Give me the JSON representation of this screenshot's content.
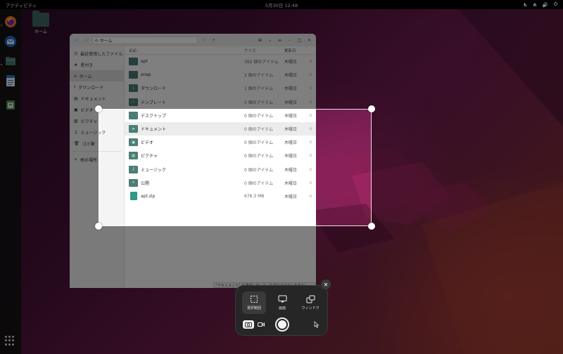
{
  "topbar": {
    "activities": "アクティビティ",
    "clock": "5月30日 12:48",
    "tray_icons": [
      "accessibility-icon",
      "network-icon",
      "volume-icon",
      "power-icon"
    ]
  },
  "dock": {
    "items": [
      "firefox-icon",
      "thunderbird-icon",
      "files-icon",
      "writer-icon",
      "trash-icon"
    ],
    "app_grid": "show-apps-icon"
  },
  "desktop": {
    "home_label": "ホーム"
  },
  "file_manager": {
    "path": "ホーム",
    "sidebar": [
      {
        "label": "最近使用したファイル",
        "icon": "clock-icon"
      },
      {
        "label": "最近使用したファイル",
        "icon": "clock-icon"
      },
      {
        "label": "星付き",
        "icon": "star-icon"
      },
      {
        "label": "ホーム",
        "icon": "home-icon",
        "active": true
      },
      {
        "label": "ダウンロード",
        "icon": "download-icon"
      },
      {
        "label": "ドキュメント",
        "icon": "document-icon"
      },
      {
        "label": "ビデオ",
        "icon": "video-icon"
      },
      {
        "label": "ピクチャ",
        "icon": "picture-icon"
      },
      {
        "label": "ミュージック",
        "icon": "music-icon"
      },
      {
        "label": "ゴミ箱",
        "icon": "trash-icon"
      },
      {
        "label": "他の場所",
        "icon": "plus-icon"
      }
    ],
    "columns": {
      "name": "名前",
      "size": "サイズ",
      "date": "更新日"
    },
    "rows": [
      {
        "name": "apt",
        "size": "382 個のアイテム",
        "date": "木曜日",
        "icon": "folder-icon",
        "glyph": ""
      },
      {
        "name": "snap",
        "size": "2 個のアイテム",
        "date": "木曜日",
        "icon": "folder-icon",
        "glyph": ""
      },
      {
        "name": "ダウンロード",
        "size": "1 個のアイテム",
        "date": "木曜日",
        "icon": "folder-download-icon",
        "glyph": "↓"
      },
      {
        "name": "テンプレート",
        "size": "0 個のアイテム",
        "date": "木曜日",
        "icon": "folder-template-icon",
        "glyph": "▭"
      },
      {
        "name": "デスクトップ",
        "size": "0 個のアイテム",
        "date": "木曜日",
        "icon": "folder-desktop-icon",
        "glyph": ""
      },
      {
        "name": "ドキュメント",
        "size": "0 個のアイテム",
        "date": "木曜日",
        "icon": "folder-document-icon",
        "glyph": "≡",
        "selected": true
      },
      {
        "name": "ビデオ",
        "size": "0 個のアイテム",
        "date": "木曜日",
        "icon": "folder-video-icon",
        "glyph": "▣"
      },
      {
        "name": "ピクチャ",
        "size": "0 個のアイテム",
        "date": "木曜日",
        "icon": "folder-picture-icon",
        "glyph": "▨"
      },
      {
        "name": "ミュージック",
        "size": "0 個のアイテム",
        "date": "木曜日",
        "icon": "folder-music-icon",
        "glyph": "♫"
      },
      {
        "name": "公開",
        "size": "0 個のアイテム",
        "date": "木曜日",
        "icon": "folder-public-icon",
        "glyph": "<"
      },
      {
        "name": "apt.zip",
        "size": "676.3 MB",
        "date": "木曜日",
        "icon": "zip-icon",
        "glyph": ""
      }
    ],
    "status": "\"ドキュメント\" を選択しました（0 個のアイテムを含む）"
  },
  "screenshot_ui": {
    "modes": [
      {
        "label": "選択範囲",
        "icon": "selection-icon",
        "active": true
      },
      {
        "label": "画面",
        "icon": "monitor-icon",
        "active": false
      },
      {
        "label": "ウィンドウ",
        "icon": "window-icon",
        "active": false
      }
    ],
    "capture_types": [
      "camera-icon",
      "video-camera-icon"
    ],
    "shutter": "shutter-button",
    "pointer": "pointer-icon",
    "close": "✕"
  }
}
